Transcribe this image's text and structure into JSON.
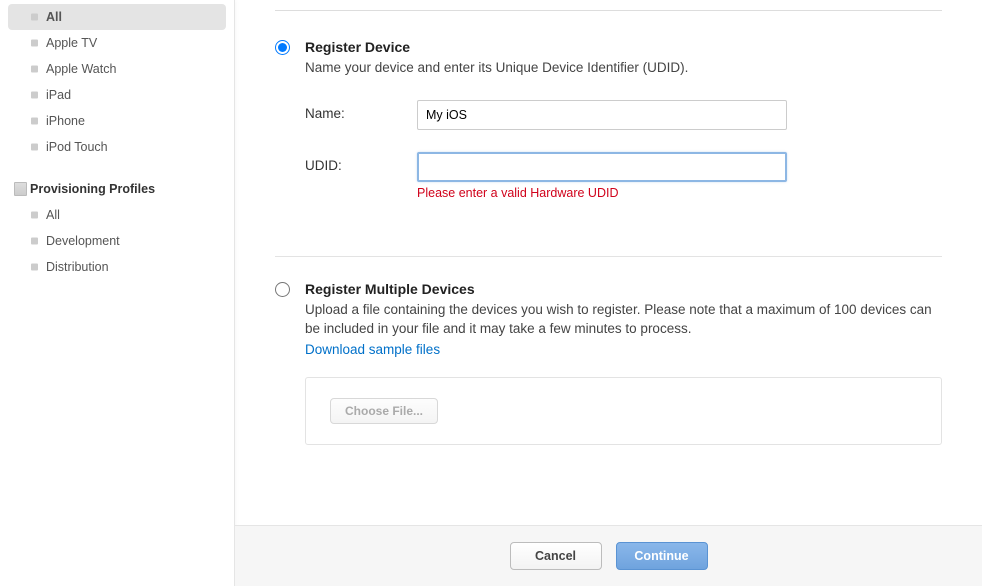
{
  "sidebar": {
    "devices": {
      "items": [
        {
          "label": "All"
        },
        {
          "label": "Apple TV"
        },
        {
          "label": "Apple Watch"
        },
        {
          "label": "iPad"
        },
        {
          "label": "iPhone"
        },
        {
          "label": "iPod Touch"
        }
      ]
    },
    "provisioning": {
      "title": "Provisioning Profiles",
      "items": [
        {
          "label": "All"
        },
        {
          "label": "Development"
        },
        {
          "label": "Distribution"
        }
      ]
    }
  },
  "form": {
    "registerDevice": {
      "title": "Register Device",
      "desc": "Name your device and enter its Unique Device Identifier (UDID).",
      "nameLabel": "Name:",
      "nameValue": "My iOS",
      "udidLabel": "UDID:",
      "udidValue": "",
      "udidError": "Please enter a valid Hardware UDID"
    },
    "registerMultiple": {
      "title": "Register Multiple Devices",
      "desc": "Upload a file containing the devices you wish to register. Please note that a maximum of 100 devices can be included in your file and it may take a few minutes to process.",
      "downloadLink": "Download sample files",
      "chooseFile": "Choose File..."
    }
  },
  "footer": {
    "cancel": "Cancel",
    "continue": "Continue"
  }
}
